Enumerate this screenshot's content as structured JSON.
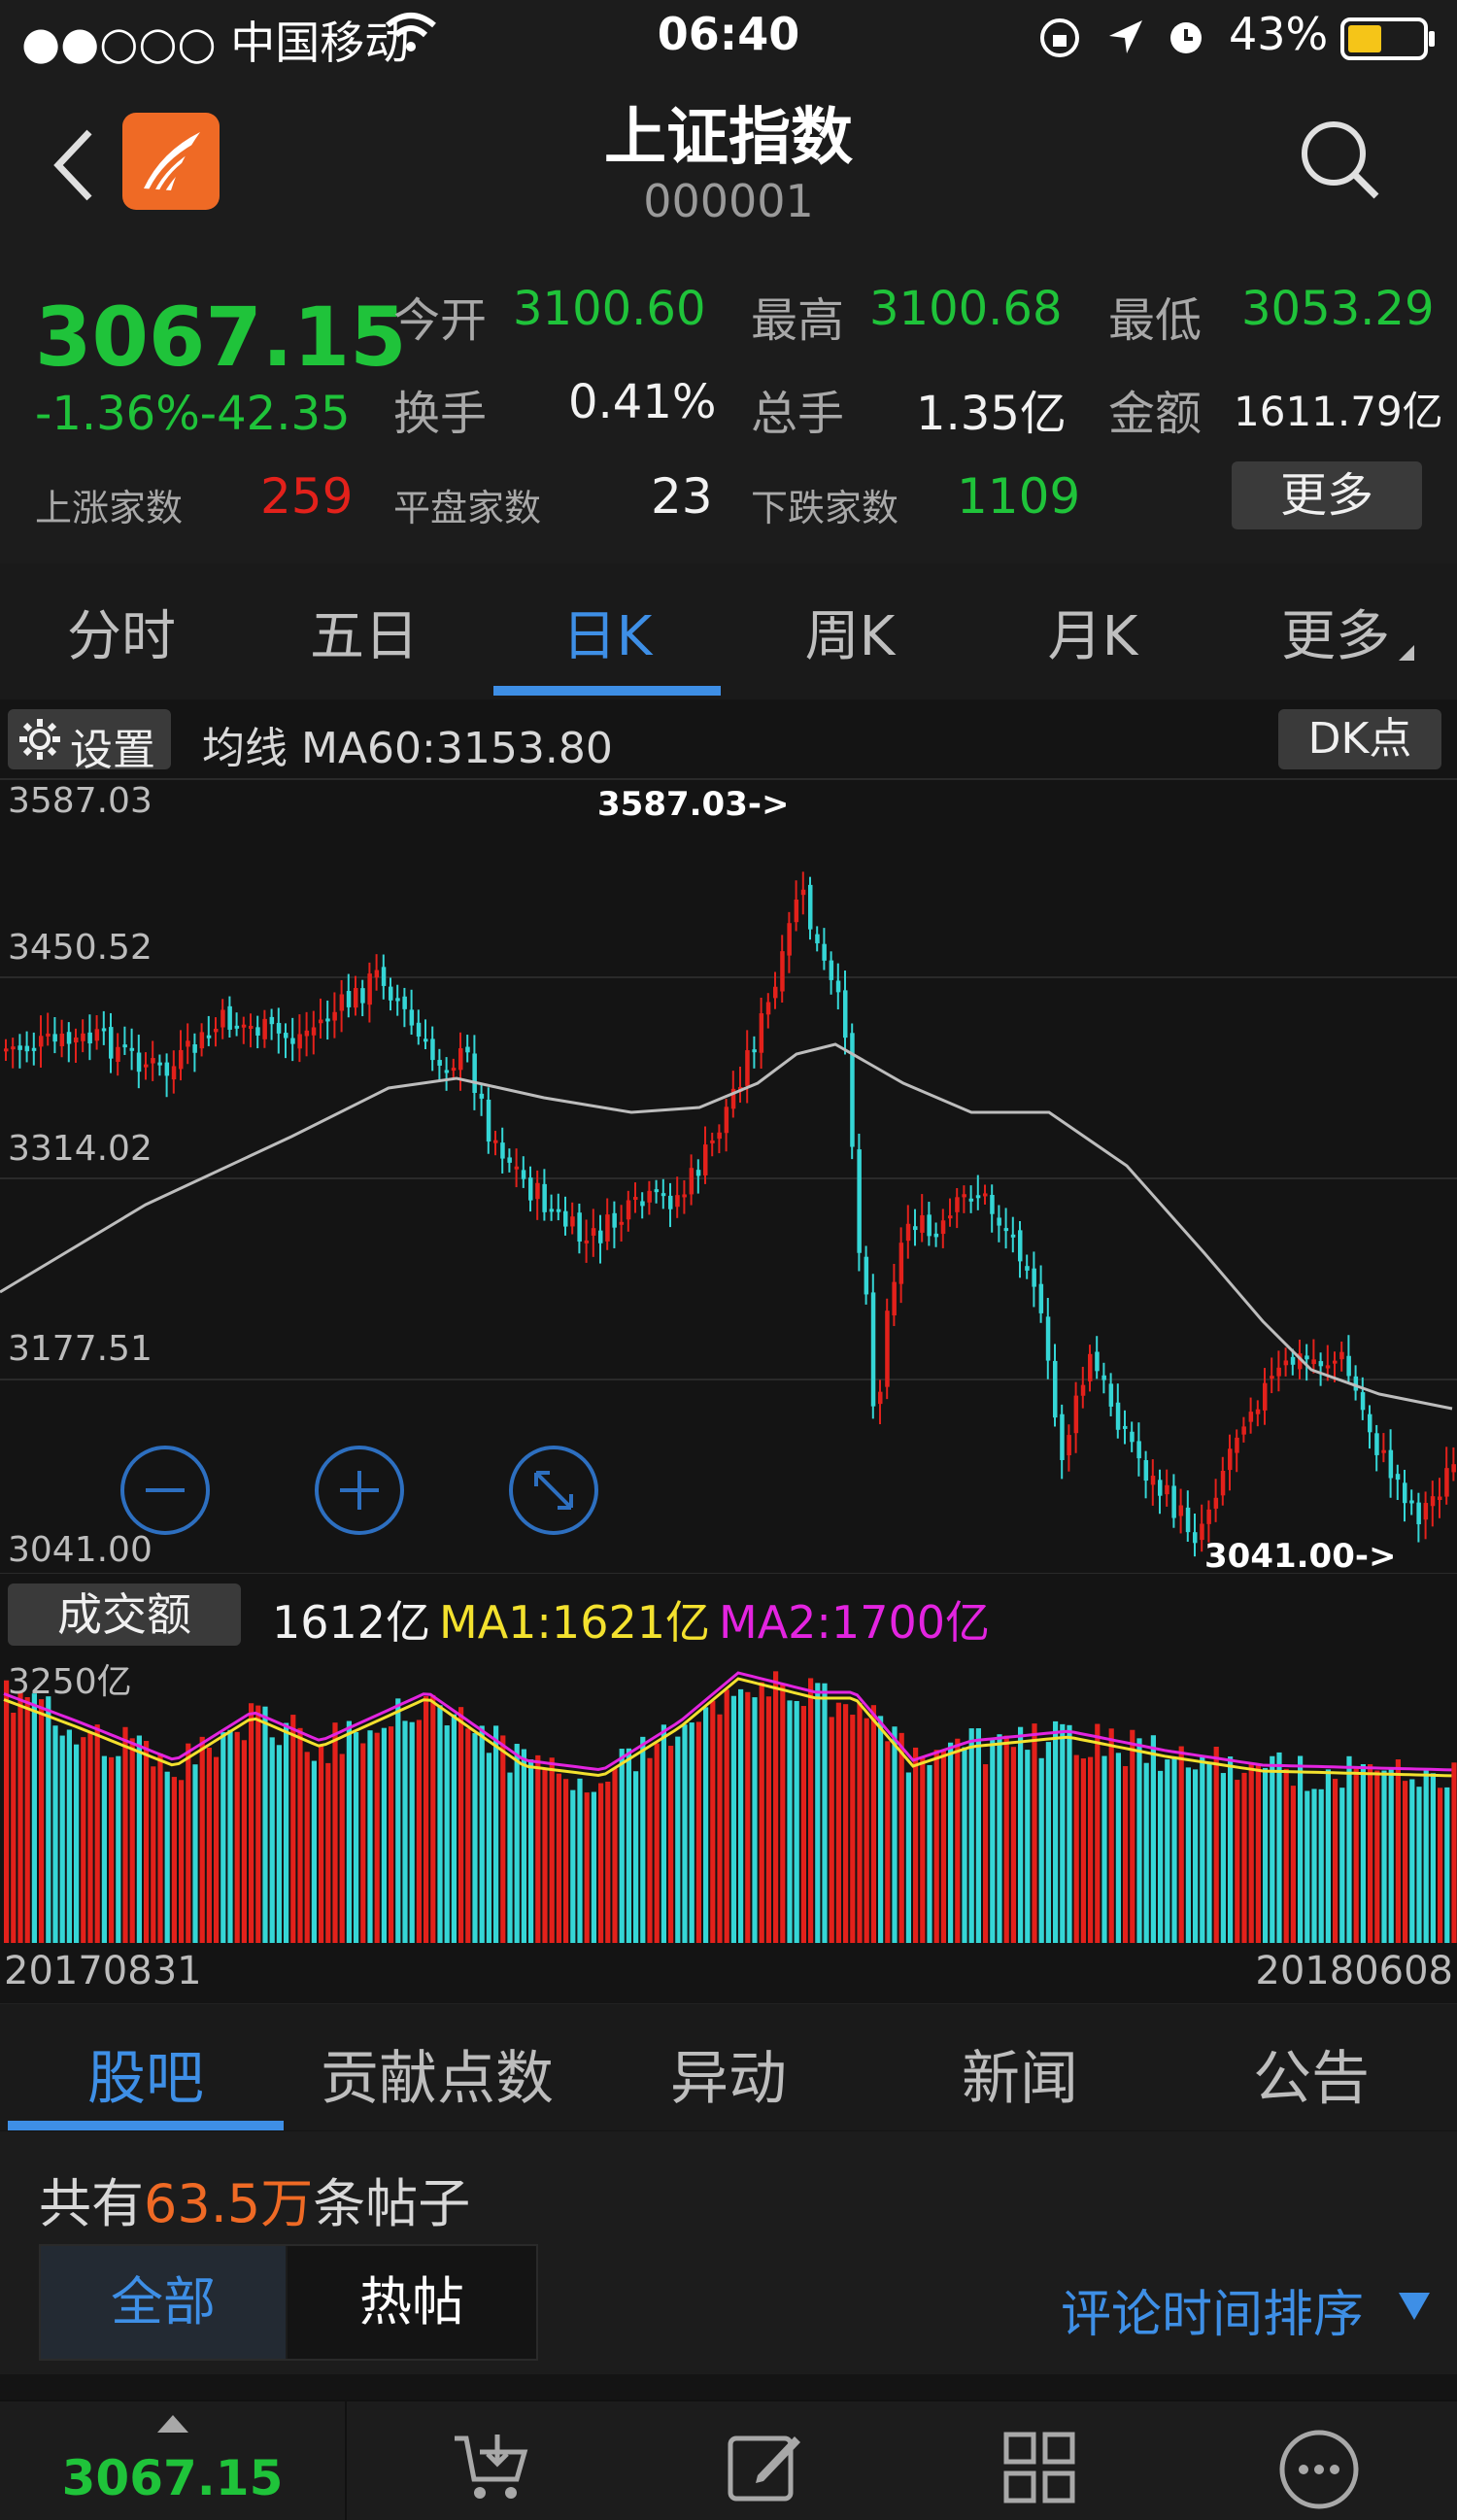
{
  "status_bar": {
    "carrier": "●●○○○ 中国移动",
    "time": "06:40",
    "battery": "43%"
  },
  "header": {
    "title": "上证指数",
    "code": "000001"
  },
  "quote": {
    "price": "3067.15",
    "change": "-1.36%-42.35",
    "open_label": "今开",
    "open": "3100.60",
    "high_label": "最高",
    "high": "3100.68",
    "low_label": "最低",
    "low": "3053.29",
    "turnover_label": "换手",
    "turnover": "0.41%",
    "volume_label": "总手",
    "volume": "1.35亿",
    "amount_label": "金额",
    "amount": "1611.79亿",
    "up_label": "上涨家数",
    "up": "259",
    "flat_label": "平盘家数",
    "flat": "23",
    "down_label": "下跌家数",
    "down": "1109",
    "more_label": "更多"
  },
  "period_tabs": [
    "分时",
    "五日",
    "日K",
    "周K",
    "月K",
    "更多"
  ],
  "settings": {
    "settings_label": "设置",
    "ma_label": "均线 MA60:3153.80",
    "dk_label": "DK点"
  },
  "kline_axis": {
    "levels": [
      "3587.03",
      "3450.52",
      "3314.02",
      "3177.51",
      "3041.00"
    ],
    "max_marker": "3587.03->",
    "min_marker": "3041.00->"
  },
  "volume": {
    "label": "成交额",
    "value": "1612亿",
    "ma1": "MA1:1621亿",
    "ma2": "MA2:1700亿",
    "top": "3250亿"
  },
  "dates": {
    "start": "20170831",
    "end": "20180608"
  },
  "bottom_tabs": [
    "股吧",
    "贡献点数",
    "异动",
    "新闻",
    "公告"
  ],
  "posts": {
    "prefix": "共有",
    "count": "63.5万",
    "suffix": "条帖子",
    "filter_all": "全部",
    "filter_hot": "热帖",
    "sort_label": "评论时间排序"
  },
  "bottom_bar": {
    "price": "3067.15"
  },
  "colors": {
    "up": "#e3211b",
    "down": "#1fc33a",
    "accent": "#3e8fe6",
    "candle_down": "#35d6d6",
    "ma1": "#f3e12e",
    "ma2": "#e324e0",
    "orange": "#ef6a25"
  }
}
